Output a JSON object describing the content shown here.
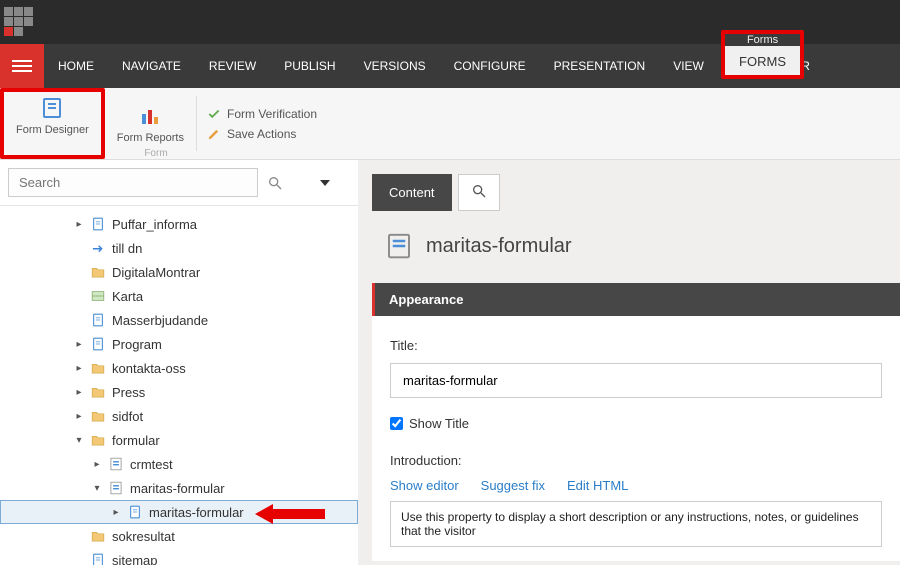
{
  "tabs": {
    "home": "HOME",
    "navigate": "NAVIGATE",
    "review": "REVIEW",
    "publish": "PUBLISH",
    "versions": "VERSIONS",
    "configure": "CONFIGURE",
    "presentation": "PRESENTATION",
    "view": "VIEW",
    "mytoolbar": "MY TOOLBAR"
  },
  "contextual": {
    "group": "Forms",
    "tab": "FORMS"
  },
  "ribbon": {
    "form_designer": "Form Designer",
    "form_reports": "Form Reports",
    "form_verification": "Form Verification",
    "save_actions": "Save Actions",
    "group_label": "Form"
  },
  "search": {
    "placeholder": "Search"
  },
  "tree": [
    {
      "label": "Puffar_informa",
      "depth": 3,
      "expand": true,
      "icon": "page"
    },
    {
      "label": "till dn",
      "depth": 3,
      "expand": false,
      "icon": "arrow"
    },
    {
      "label": "DigitalaMontrar",
      "depth": 3,
      "expand": false,
      "icon": "folder"
    },
    {
      "label": "Karta",
      "depth": 3,
      "expand": false,
      "icon": "map"
    },
    {
      "label": "Masserbjudande",
      "depth": 3,
      "expand": false,
      "icon": "page"
    },
    {
      "label": "Program",
      "depth": 3,
      "expand": true,
      "icon": "page"
    },
    {
      "label": "kontakta-oss",
      "depth": 3,
      "expand": true,
      "icon": "folder"
    },
    {
      "label": "Press",
      "depth": 3,
      "expand": true,
      "icon": "folder"
    },
    {
      "label": "sidfot",
      "depth": 3,
      "expand": true,
      "icon": "folder"
    },
    {
      "label": "formular",
      "depth": 3,
      "expand": true,
      "open": true,
      "icon": "folder"
    },
    {
      "label": "crmtest",
      "depth": 4,
      "expand": true,
      "icon": "form"
    },
    {
      "label": "maritas-formular",
      "depth": 4,
      "expand": true,
      "open": true,
      "icon": "form"
    },
    {
      "label": "maritas-formular",
      "depth": 5,
      "expand": true,
      "icon": "page",
      "selected": true
    },
    {
      "label": "sokresultat",
      "depth": 3,
      "expand": false,
      "icon": "folder"
    },
    {
      "label": "sitemap",
      "depth": 3,
      "expand": false,
      "icon": "page"
    }
  ],
  "content": {
    "tab_content": "Content",
    "title": "maritas-formular",
    "section": "Appearance",
    "field_title_label": "Title:",
    "field_title_value": "maritas-formular",
    "show_title_label": "Show Title",
    "show_title_checked": true,
    "introduction_label": "Introduction:",
    "links": {
      "show_editor": "Show editor",
      "suggest_fix": "Suggest fix",
      "edit_html": "Edit HTML"
    },
    "description_text": "Use this property to display a short description or any instructions, notes, or guidelines that the visitor"
  }
}
